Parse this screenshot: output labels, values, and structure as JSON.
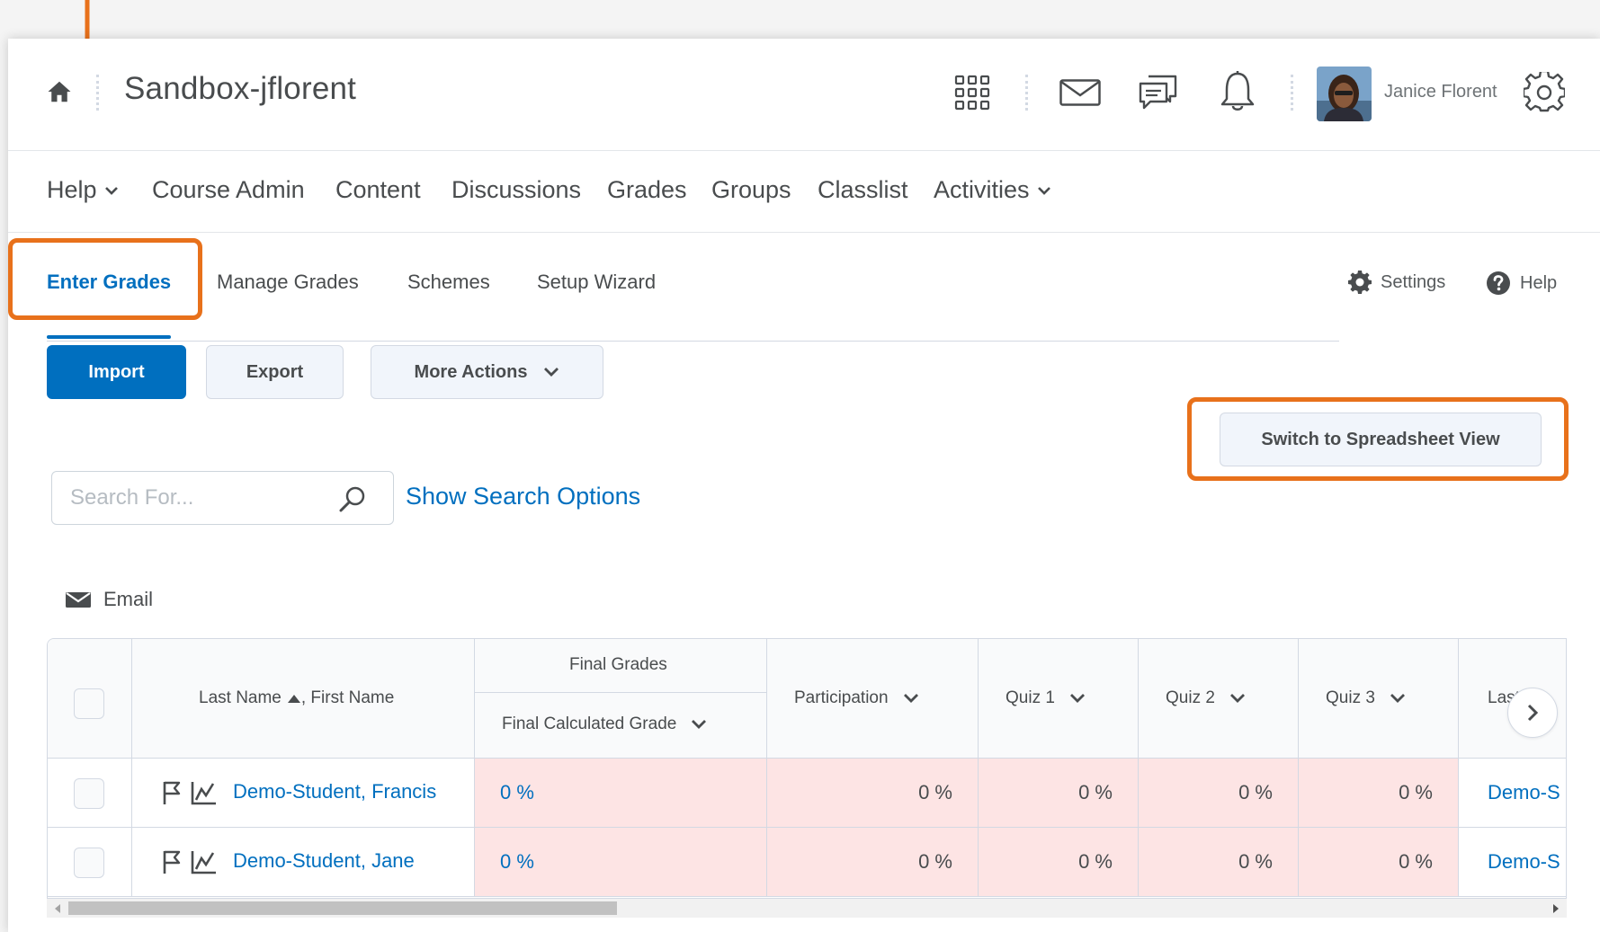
{
  "header": {
    "course_title": "Sandbox-jflorent",
    "user_name": "Janice Florent",
    "icons": [
      "home-icon",
      "waffle-icon",
      "mail-icon",
      "chat-icon",
      "bell-icon",
      "settings-gear-icon"
    ]
  },
  "nav": {
    "items": [
      {
        "label": "Help",
        "dropdown": true
      },
      {
        "label": "Course Admin",
        "dropdown": false
      },
      {
        "label": "Content",
        "dropdown": false
      },
      {
        "label": "Discussions",
        "dropdown": false
      },
      {
        "label": "Grades",
        "dropdown": false
      },
      {
        "label": "Groups",
        "dropdown": false
      },
      {
        "label": "Classlist",
        "dropdown": false
      },
      {
        "label": "Activities",
        "dropdown": true
      }
    ]
  },
  "tabs": {
    "items": [
      "Enter Grades",
      "Manage Grades",
      "Schemes",
      "Setup Wizard"
    ],
    "active": "Enter Grades",
    "settings_label": "Settings",
    "help_label": "Help"
  },
  "actions": {
    "import_label": "Import",
    "export_label": "Export",
    "more_actions_label": "More Actions",
    "switch_view_label": "Switch to Spreadsheet View"
  },
  "search": {
    "placeholder": "Search For...",
    "value": "",
    "options_link": "Show Search Options"
  },
  "email_label": "Email",
  "table": {
    "name_header": "Last Name",
    "name_header_suffix": ", First Name",
    "group_header": "Final Grades",
    "final_header": "Final Calculated Grade",
    "columns": [
      "Participation",
      "Quiz 1",
      "Quiz 2",
      "Quiz 3"
    ],
    "last_column_partial": "Last N",
    "rows": [
      {
        "name": "Demo-Student, Francis",
        "final": "0 %",
        "values": [
          "0 %",
          "0 %",
          "0 %",
          "0 %"
        ],
        "last_partial": "Demo-S"
      },
      {
        "name": "Demo-Student, Jane",
        "final": "0 %",
        "values": [
          "0 %",
          "0 %",
          "0 %",
          "0 %"
        ],
        "last_partial": "Demo-S"
      }
    ]
  },
  "colors": {
    "accent": "#006fbf",
    "annotation": "#e8711b",
    "grade_cell_bg": "#fde4e4"
  }
}
